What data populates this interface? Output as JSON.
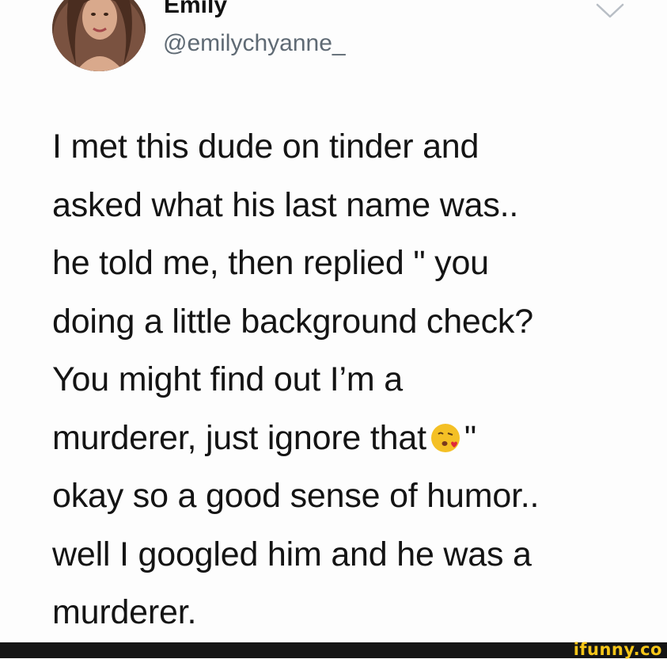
{
  "tweet": {
    "display_name": "Emily",
    "handle": "@emilychyanne_",
    "lines": [
      "I met this dude on tinder and",
      "asked what his last name was..",
      "he told me, then replied \" you",
      "doing a little background check?",
      "You might find out I’m a",
      "okay so a good sense of humor..",
      "well I googled him and he was a",
      "murderer."
    ],
    "line_emoji": {
      "before": "murderer, just ignore that",
      "after": "\"",
      "emoji_name": "kissing-face-with-heart-icon"
    },
    "menu_icon": "chevron-down-icon"
  },
  "watermark": {
    "text": "ifunny.co"
  },
  "colors": {
    "text": "#141414",
    "handle": "#5f6a74",
    "chevron": "#b8bec5",
    "footer": "#141414",
    "watermark": "#f5c518"
  }
}
